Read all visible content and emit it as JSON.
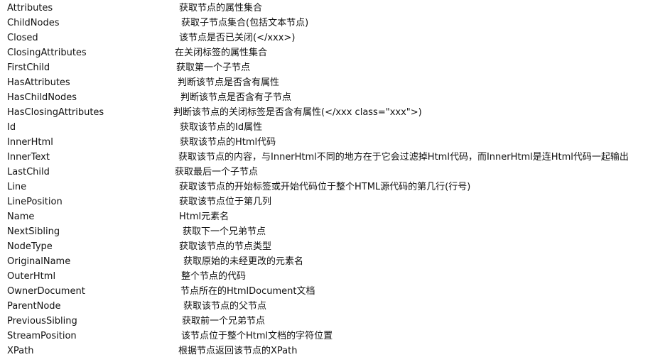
{
  "rows": [
    {
      "property": "Attributes",
      "description": "获取节点的属性集合"
    },
    {
      "property": "ChildNodes",
      "description": "获取子节点集合(包括文本节点)"
    },
    {
      "property": "Closed",
      "description": "该节点是否已关闭(</xxx>)"
    },
    {
      "property": "ClosingAttributes",
      "description": "在关闭标签的属性集合"
    },
    {
      "property": "FirstChild",
      "description": "获取第一个子节点"
    },
    {
      "property": "HasAttributes",
      "description": "判断该节点是否含有属性"
    },
    {
      "property": "HasChildNodes",
      "description": "判断该节点是否含有子节点"
    },
    {
      "property": "HasClosingAttributes",
      "description": "判断该节点的关闭标签是否含有属性(</xxx class=\"xxx\">)"
    },
    {
      "property": "Id",
      "description": "获取该节点的Id属性"
    },
    {
      "property": "InnerHtml",
      "description": "获取该节点的Html代码"
    },
    {
      "property": "InnerText",
      "description": "获取该节点的内容，与InnerHtml不同的地方在于它会过滤掉Html代码，而InnerHtml是连Html代码一起输出"
    },
    {
      "property": "LastChild",
      "description": "获取最后一个子节点"
    },
    {
      "property": "Line",
      "description": "获取该节点的开始标签或开始代码位于整个HTML源代码的第几行(行号)"
    },
    {
      "property": "LinePosition",
      "description": "获取该节点位于第几列"
    },
    {
      "property": "Name",
      "description": "Html元素名"
    },
    {
      "property": "NextSibling",
      "description": "获取下一个兄弟节点"
    },
    {
      "property": "NodeType",
      "description": "获取该节点的节点类型"
    },
    {
      "property": "OriginalName",
      "description": "获取原始的未经更改的元素名"
    },
    {
      "property": "OuterHtml",
      "description": "整个节点的代码"
    },
    {
      "property": "OwnerDocument",
      "description": "节点所在的HtmlDocument文档"
    },
    {
      "property": "ParentNode",
      "description": "获取该节点的父节点"
    },
    {
      "property": "PreviousSibling",
      "description": "获取前一个兄弟节点"
    },
    {
      "property": "StreamPosition",
      "description": "该节点位于整个Html文档的字符位置"
    },
    {
      "property": "XPath",
      "description": "根据节点返回该节点的XPath"
    }
  ]
}
